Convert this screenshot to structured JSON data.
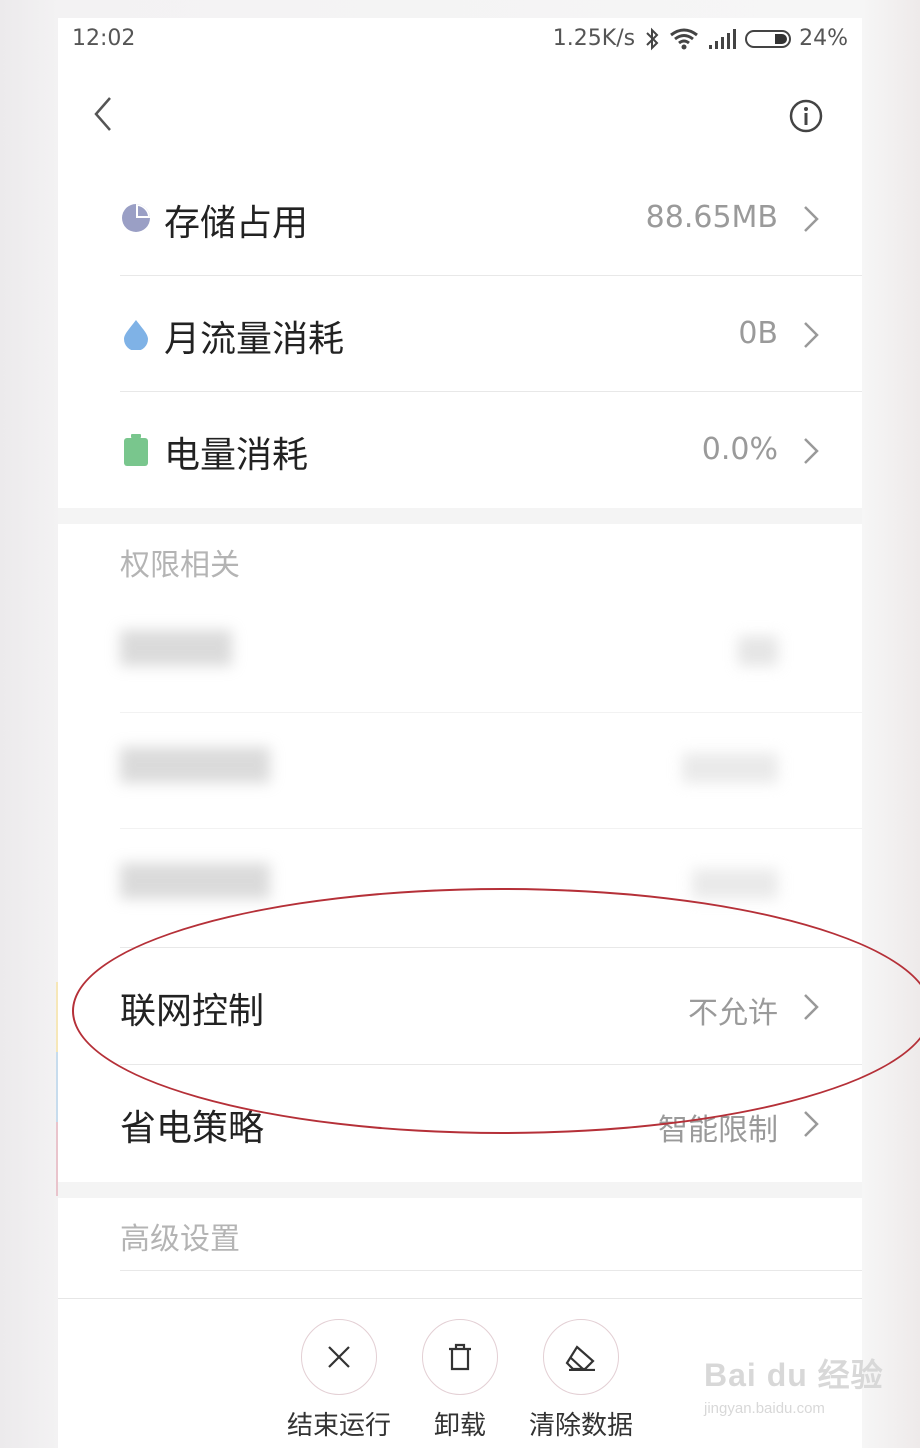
{
  "status_bar": {
    "time": "12:02",
    "network_speed": "1.25K/s",
    "battery_percent": "24%",
    "battery_level": 0.24
  },
  "header": {
    "title": "",
    "back_icon": "chevron-left-icon",
    "info_icon": "info-circle-icon"
  },
  "usage": {
    "items": [
      {
        "label": "存储占用",
        "value": "88.65MB",
        "icon": "pie-chart-icon",
        "icon_color": "#9a9fc5"
      },
      {
        "label": "月流量消耗",
        "value": "0B",
        "icon": "water-drop-icon",
        "icon_color": "#7fb2e6"
      },
      {
        "label": "电量消耗",
        "value": "0.0%",
        "icon": "battery-icon",
        "icon_color": "#79c68d"
      }
    ]
  },
  "permissions": {
    "header": "权限相关",
    "items": [
      {
        "label": "",
        "value": ""
      },
      {
        "label": "",
        "value": ""
      },
      {
        "label": "",
        "value": ""
      },
      {
        "label": "联网控制",
        "value": "不允许"
      },
      {
        "label": "省电策略",
        "value": "智能限制"
      }
    ]
  },
  "advanced": {
    "header": "高级设置"
  },
  "actions": [
    {
      "label": "结束运行",
      "icon": "close-icon"
    },
    {
      "label": "卸载",
      "icon": "trash-icon"
    },
    {
      "label": "清除数据",
      "icon": "eraser-icon"
    }
  ],
  "annotation_color": "#b53038",
  "watermark": {
    "brand": "Bai du 经验",
    "url": "jingyan.baidu.com"
  }
}
